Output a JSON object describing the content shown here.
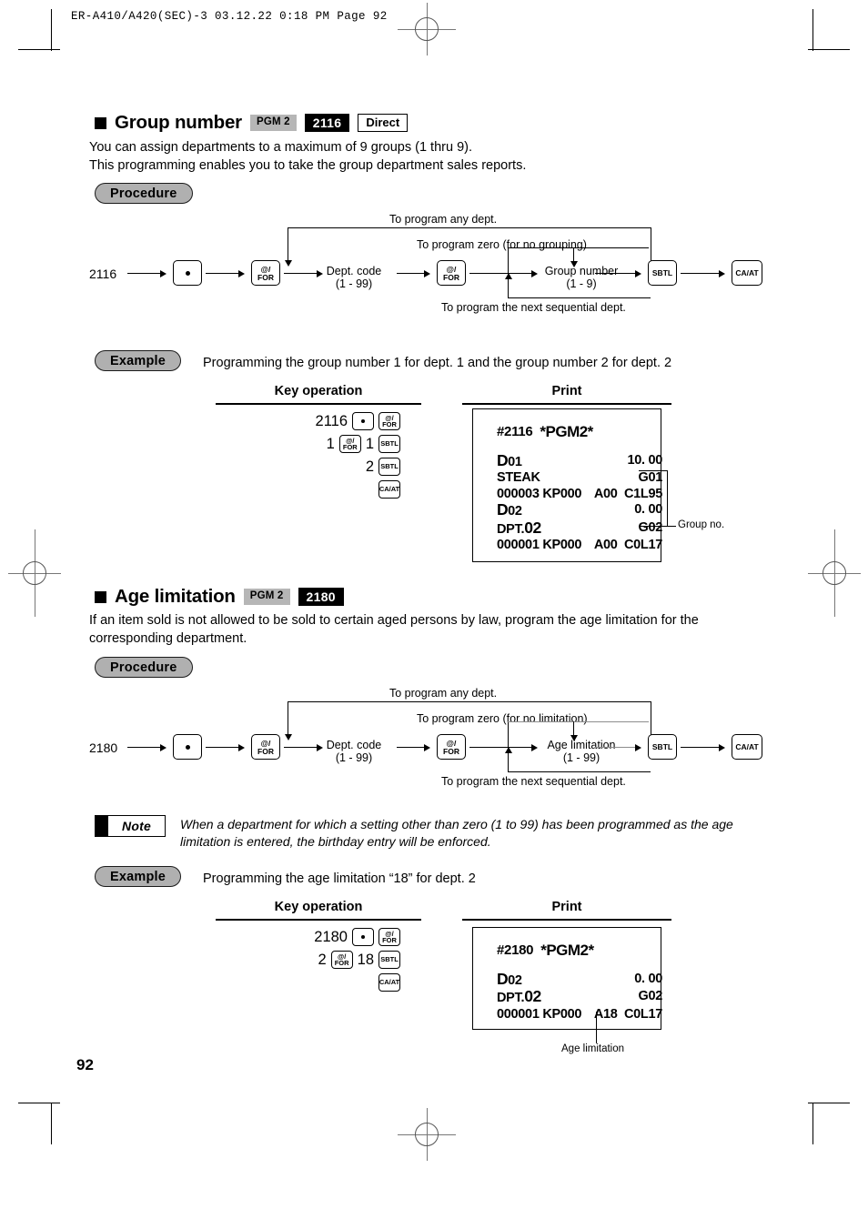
{
  "page": {
    "printer_header": "ER-A410/A420(SEC)-3   03.12.22 0:18 PM   Page 92",
    "page_number": "92"
  },
  "sections": [
    {
      "title": "Group number",
      "badges": {
        "mode": "PGM 2",
        "code": "2116",
        "direct": "Direct"
      },
      "description_lines": [
        "You can assign departments to a maximum of 9 groups (1 thru 9).",
        "This programming enables you to take the group department sales reports."
      ],
      "procedure_label": "Procedure",
      "flow": {
        "start": "2116",
        "top_label": "To program any dept.",
        "mid_label": "To program zero (for no grouping)",
        "bottom_label": "To program the next sequential dept.",
        "node1_line1": "Dept. code",
        "node1_line2": "(1 - 99)",
        "node2_line1": "Group number",
        "node2_line2": "(1 - 9)",
        "key_dot": "●",
        "key_for_top": "@/",
        "key_for_bottom": "FOR",
        "key_sbtl": "SBTL",
        "key_caat": "CA/AT"
      },
      "example_label": "Example",
      "example_text": "Programming the group number 1 for dept. 1 and the group number 2 for dept. 2",
      "col_key_operation": "Key operation",
      "col_print": "Print",
      "key_rows": [
        {
          "num": "2116",
          "keys": [
            "dot",
            "for"
          ]
        },
        {
          "num": "1",
          "keys": [
            "for"
          ],
          "num2": "1",
          "keys2": [
            "sbtl"
          ]
        },
        {
          "num": "2",
          "keys": [
            "sbtl"
          ]
        },
        {
          "num": "",
          "keys": [
            "caat"
          ]
        }
      ],
      "receipt": {
        "title_left": "#2116",
        "title_right": "*PGM2*",
        "lines": [
          {
            "left": "D01",
            "right": "10. 00",
            "bold_lead": 1
          },
          {
            "left": "STEAK",
            "right": "G01"
          },
          {
            "left": "000003 KP000",
            "right": "A00  C1L95"
          },
          {
            "left": "D02",
            "right": "0. 00",
            "bold_lead": 1
          },
          {
            "left": "DPT.02",
            "right": "G02",
            "bold_tail": 2
          },
          {
            "left": "000001 KP000",
            "right": "A00  C0L17"
          }
        ]
      },
      "callout_text": "Group no."
    },
    {
      "title": "Age limitation",
      "badges": {
        "mode": "PGM 2",
        "code": "2180",
        "direct": ""
      },
      "description_lines": [
        "If an item sold is not allowed to be sold to certain aged persons by law, program the age limitation for the",
        "corresponding department."
      ],
      "procedure_label": "Procedure",
      "flow": {
        "start": "2180",
        "top_label": "To program any dept.",
        "mid_label": "To program zero (for no limitation)",
        "bottom_label": "To program the next sequential dept.",
        "node1_line1": "Dept. code",
        "node1_line2": "(1 - 99)",
        "node2_line1": "Age limitation",
        "node2_line2": "(1 - 99)",
        "key_dot": "●",
        "key_for_top": "@/",
        "key_for_bottom": "FOR",
        "key_sbtl": "SBTL",
        "key_caat": "CA/AT"
      },
      "note_label": "Note",
      "note_lines": [
        "When a department for which a setting other than zero (1 to 99) has been programmed as the age",
        "limitation is entered, the birthday entry will be enforced."
      ],
      "example_label": "Example",
      "example_text": "Programming the age limitation “18” for dept. 2",
      "col_key_operation": "Key operation",
      "col_print": "Print",
      "key_rows": [
        {
          "num": "2180",
          "keys": [
            "dot",
            "for"
          ]
        },
        {
          "num": "2",
          "keys": [
            "for"
          ],
          "num2": "18",
          "keys2": [
            "sbtl"
          ]
        },
        {
          "num": "",
          "keys": [
            "caat"
          ]
        }
      ],
      "receipt": {
        "title_left": "#2180",
        "title_right": "*PGM2*",
        "lines": [
          {
            "left": "D02",
            "right": "0. 00",
            "bold_lead": 1
          },
          {
            "left": "DPT.02",
            "right": "G02",
            "bold_tail": 2
          },
          {
            "left": "000001 KP000",
            "right": "A18  C0L17"
          }
        ]
      },
      "callout_text": "Age limitation"
    }
  ]
}
